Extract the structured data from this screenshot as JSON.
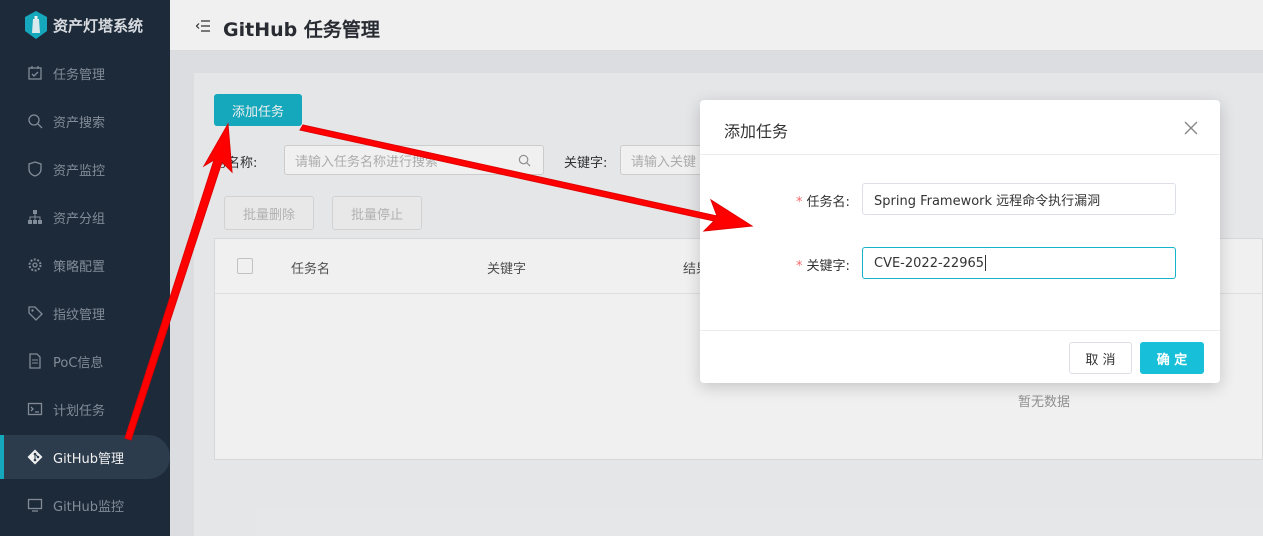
{
  "app": {
    "brand": "资产灯塔系统"
  },
  "sidebar": {
    "items": [
      {
        "label": "任务管理",
        "icon": "calendar-check-icon",
        "active": false
      },
      {
        "label": "资产搜索",
        "icon": "search-icon",
        "active": false
      },
      {
        "label": "资产监控",
        "icon": "shield-icon",
        "active": false
      },
      {
        "label": "资产分组",
        "icon": "sitemap-icon",
        "active": false
      },
      {
        "label": "策略配置",
        "icon": "gear-icon",
        "active": false
      },
      {
        "label": "指纹管理",
        "icon": "tag-icon",
        "active": false
      },
      {
        "label": "PoC信息",
        "icon": "document-icon",
        "active": false
      },
      {
        "label": "计划任务",
        "icon": "terminal-icon",
        "active": false
      },
      {
        "label": "GitHub管理",
        "icon": "git-icon",
        "active": true
      },
      {
        "label": "GitHub监控",
        "icon": "monitor-icon",
        "active": false
      }
    ]
  },
  "header": {
    "title": "GitHub 任务管理"
  },
  "main": {
    "add_button": "添加任务",
    "filters": [
      {
        "label": "务名称:",
        "placeholder": "请输入任务名称进行搜索"
      },
      {
        "label": "关键字:",
        "placeholder": "请输入关键"
      }
    ],
    "batch_delete": "批量删除",
    "batch_stop": "批量停止",
    "table": {
      "columns": [
        "任务名",
        "关键字",
        "结果"
      ],
      "empty_text": "暂无数据"
    }
  },
  "dialog": {
    "title": "添加任务",
    "fields": [
      {
        "label": "任务名:",
        "value": "Spring Framework 远程命令执行漏洞",
        "required": true
      },
      {
        "label": "关键字:",
        "value": "CVE-2022-22965",
        "required": true
      }
    ],
    "cancel": "取 消",
    "confirm": "确 定"
  },
  "colors": {
    "accent": "#17b3c8",
    "sidebar_bg": "#1f2d3d",
    "arrow": "#ff0000"
  }
}
